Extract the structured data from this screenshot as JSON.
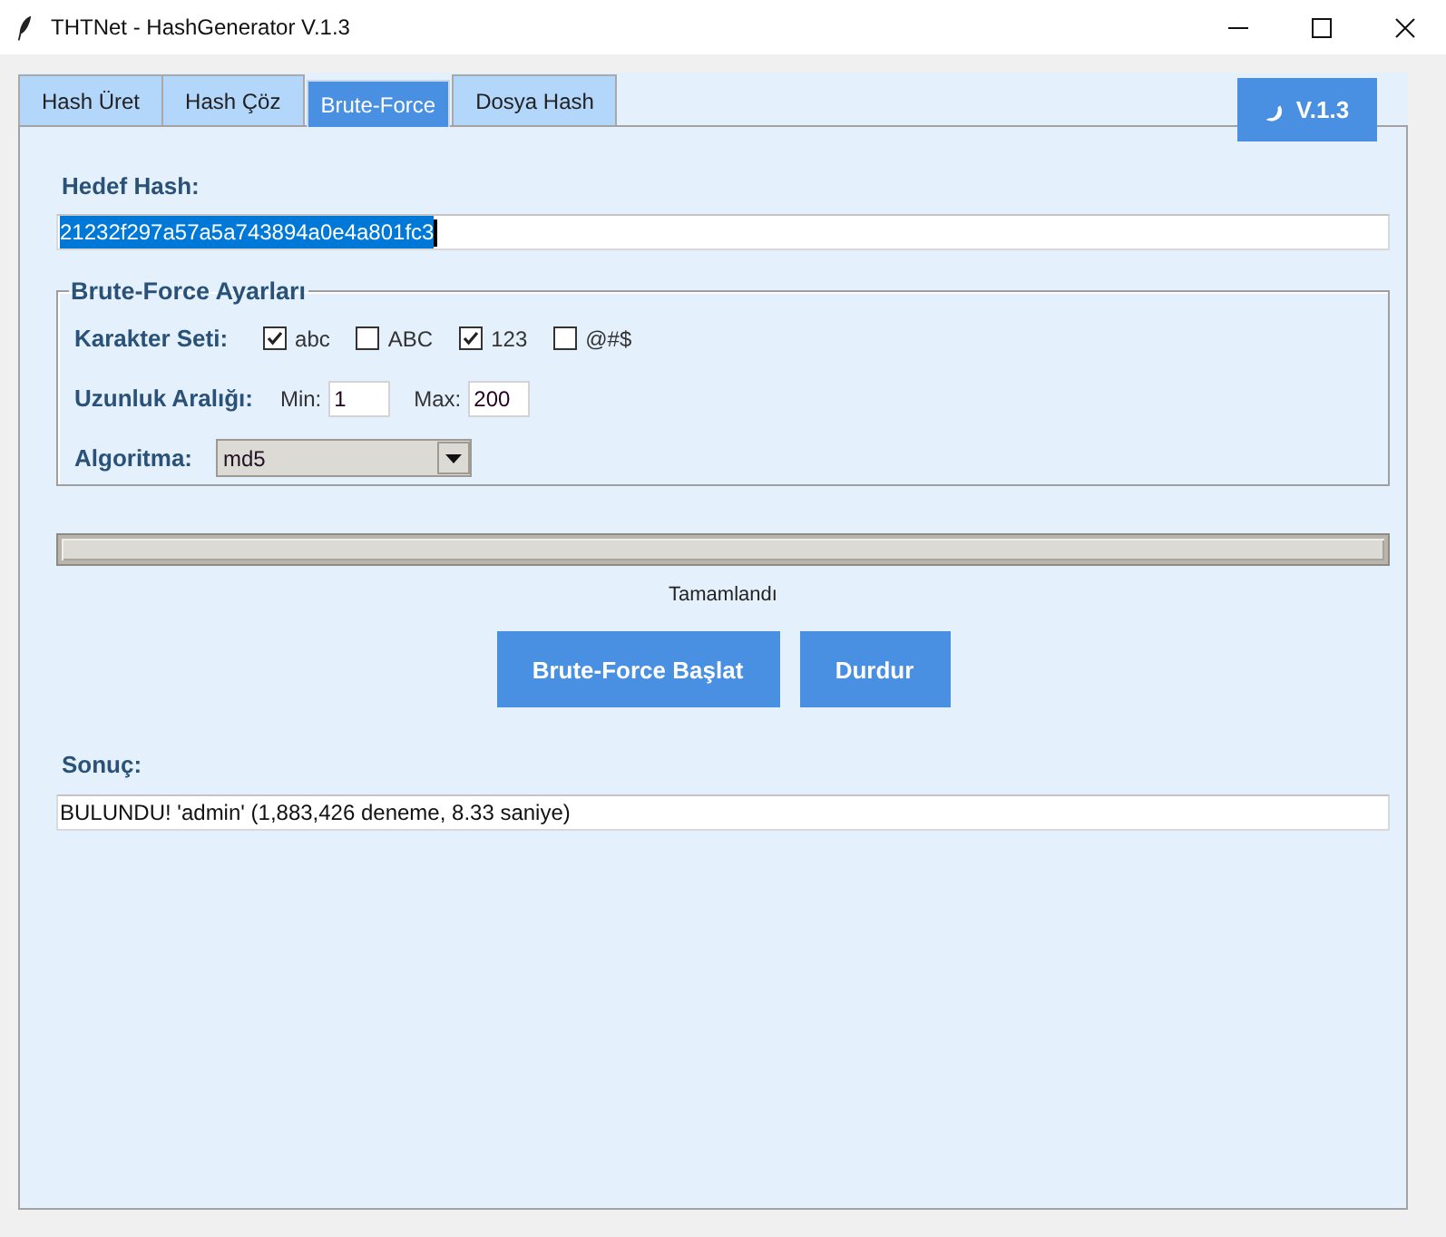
{
  "window": {
    "title": "THTNet - HashGenerator V.1.3"
  },
  "tabs": [
    {
      "label": "Hash Üret",
      "selected": false
    },
    {
      "label": "Hash Çöz",
      "selected": false
    },
    {
      "label": "Brute-Force",
      "selected": true
    },
    {
      "label": "Dosya Hash",
      "selected": false
    }
  ],
  "version_button": {
    "label": "V.1.3"
  },
  "target_hash": {
    "label": "Hedef Hash:",
    "value": "21232f297a57a5a743894a0e4a801fc3",
    "text_selected": true
  },
  "settings": {
    "title": "Brute-Force Ayarları",
    "charset": {
      "label": "Karakter Seti:",
      "options": [
        {
          "label": "abc",
          "checked": true
        },
        {
          "label": "ABC",
          "checked": false
        },
        {
          "label": "123",
          "checked": true
        },
        {
          "label": "@#$",
          "checked": false
        }
      ]
    },
    "length": {
      "label": "Uzunluk Aralığı:",
      "min_label": "Min:",
      "min_value": "1",
      "max_label": "Max:",
      "max_value": "200"
    },
    "algorithm": {
      "label": "Algoritma:",
      "value": "md5"
    }
  },
  "progress": {
    "level": 1,
    "status": "Tamamlandı"
  },
  "buttons": [
    {
      "label": "Brute-Force Başlat"
    },
    {
      "label": "Durdur"
    }
  ],
  "result": {
    "label": "Sonuç:",
    "value": "BULUNDU! 'admin' (1,883,426 deneme, 8.33 saniye)"
  }
}
